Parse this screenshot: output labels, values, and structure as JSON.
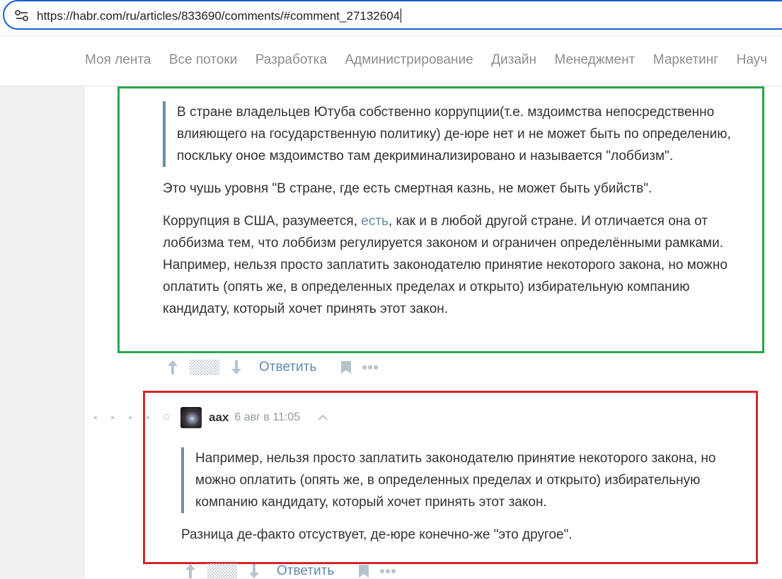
{
  "browser": {
    "url": "https://habr.com/ru/articles/833690/comments/#comment_27132604"
  },
  "nav": {
    "items": [
      "Моя лента",
      "Все потоки",
      "Разработка",
      "Администрирование",
      "Дизайн",
      "Менеджмент",
      "Маркетинг",
      "Науч"
    ]
  },
  "comment1": {
    "quote": "В стране владельцев Ютуба собственно коррупции(т.е. мздоимства непосредственно влияющего на государственную политику) де-юре нет и не может быть по определению, поскльку оное мздоимство там декриминализировано и называется \"лоббизм\".",
    "para1": "Это чушь уровня \"В стране, где есть смертная казнь, не может быть убийств\".",
    "para2_before": "Коррупция в США, разумеется, ",
    "para2_link": "есть",
    "para2_after": ", как и в любой другой стране. И отличается она от лоббизма тем, что лоббизм регулируется законом и ограничен определёнными рамками. Например, нельзя просто заплатить законодателю принятие некоторого закона, но можно оплатить (опять же, в определенных пределах и открыто) избирательную компанию кандидату, который хочет принять этот закон.",
    "reply_label": "Ответить"
  },
  "comment2": {
    "author": "aax",
    "timestamp": "6 авг в 11:05",
    "quote": "Например, нельзя просто заплатить законодателю принятие некоторого закона, но можно оплатить (опять же, в определенных пределах и открыто) избирательную компанию кандидату, который хочет принять этот закон.",
    "para1": "Разница де-факто отсуствует, де-юре конечно-же \"это другое\".",
    "reply_label": "Ответить"
  },
  "colors": {
    "highlight_green": "#2aa84a",
    "highlight_red": "#d3262e",
    "link": "#5e8bab",
    "url_focus": "#1a5fd0"
  },
  "icons": [
    "site-settings-icon",
    "upvote-arrow-icon",
    "rating-hidden-icon",
    "downvote-arrow-icon",
    "bookmark-icon",
    "more-icon",
    "collapse-chevron-icon"
  ]
}
